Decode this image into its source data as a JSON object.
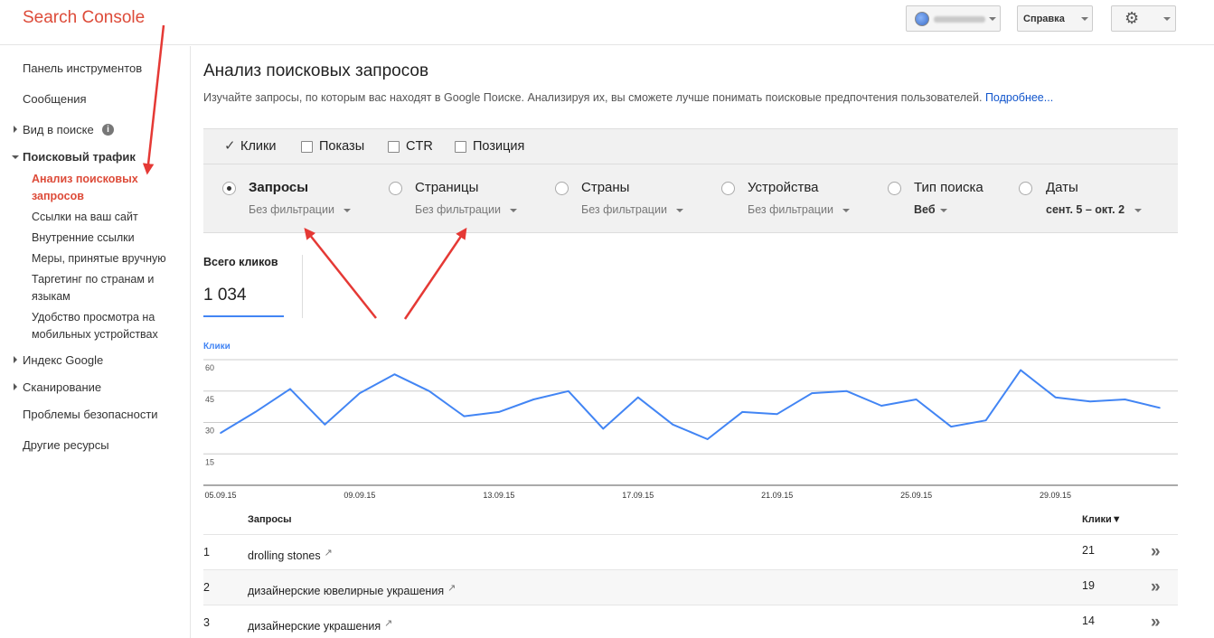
{
  "header": {
    "logo": "Search Console",
    "help_label": "Справка"
  },
  "sidebar": {
    "dashboard": "Панель инструментов",
    "messages": "Сообщения",
    "search_appearance": "Вид в поиске",
    "search_traffic": "Поисковый трафик",
    "sub": {
      "search_analytics": "Анализ поисковых запросов",
      "links_to_site": "Ссылки на ваш сайт",
      "internal_links": "Внутренние ссылки",
      "manual_actions": "Меры, принятые вручную",
      "intl_targeting": "Таргетинг по странам и языкам",
      "mobile_usability": "Удобство просмотра на мобильных устройствах"
    },
    "google_index": "Индекс Google",
    "crawl": "Сканирование",
    "security_issues": "Проблемы безопасности",
    "other_resources": "Другие ресурсы"
  },
  "main": {
    "title": "Анализ поисковых запросов",
    "description": "Изучайте запросы, по которым вас находят в Google Поиске. Анализируя их, вы сможете лучше понимать поисковые предпочтения пользователей.",
    "more_link": "Подробнее..."
  },
  "metrics": [
    {
      "label": "Клики",
      "checked": true
    },
    {
      "label": "Показы",
      "checked": false
    },
    {
      "label": "CTR",
      "checked": false
    },
    {
      "label": "Позиция",
      "checked": false
    }
  ],
  "dimensions": [
    {
      "label": "Запросы",
      "filter": "Без фильтрации",
      "selected": true
    },
    {
      "label": "Страницы",
      "filter": "Без фильтрации",
      "selected": false
    },
    {
      "label": "Страны",
      "filter": "Без фильтрации",
      "selected": false
    },
    {
      "label": "Устройства",
      "filter": "Без фильтрации",
      "selected": false
    },
    {
      "label": "Тип поиска",
      "filter": "Веб",
      "selected": false
    },
    {
      "label": "Даты",
      "filter": "сент. 5 – окт. 2",
      "selected": false
    }
  ],
  "total": {
    "label": "Всего кликов",
    "value": "1 034"
  },
  "chart_data": {
    "type": "line",
    "series": [
      {
        "name": "Клики",
        "color": "#4285f4",
        "values": [
          25,
          35,
          46,
          29,
          44,
          53,
          45,
          33,
          35,
          41,
          45,
          27,
          42,
          29,
          22,
          35,
          34,
          44,
          45,
          38,
          41,
          28,
          31,
          55,
          42,
          40,
          41,
          37
        ]
      }
    ],
    "x": [
      "05.09.15",
      "06.09.15",
      "07.09.15",
      "08.09.15",
      "09.09.15",
      "10.09.15",
      "11.09.15",
      "12.09.15",
      "13.09.15",
      "14.09.15",
      "15.09.15",
      "16.09.15",
      "17.09.15",
      "18.09.15",
      "19.09.15",
      "20.09.15",
      "21.09.15",
      "22.09.15",
      "23.09.15",
      "24.09.15",
      "25.09.15",
      "26.09.15",
      "27.09.15",
      "28.09.15",
      "29.09.15",
      "30.09.15",
      "01.10.15",
      "02.10.15"
    ],
    "x_tick_labels": [
      "05.09.15",
      "09.09.15",
      "13.09.15",
      "17.09.15",
      "21.09.15",
      "25.09.15",
      "29.09.15"
    ],
    "y_ticks": [
      "60",
      "45",
      "30",
      "15"
    ],
    "ylim": [
      0,
      60
    ],
    "grid": true
  },
  "table": {
    "col_query": "Запросы",
    "col_clicks": "Клики▼",
    "rows": [
      {
        "n": "1",
        "query": "drolling stones",
        "clicks": "21"
      },
      {
        "n": "2",
        "query": "дизайнерские ювелирные украшения",
        "clicks": "19"
      },
      {
        "n": "3",
        "query": "дизайнерские украшения",
        "clicks": "14"
      }
    ]
  }
}
